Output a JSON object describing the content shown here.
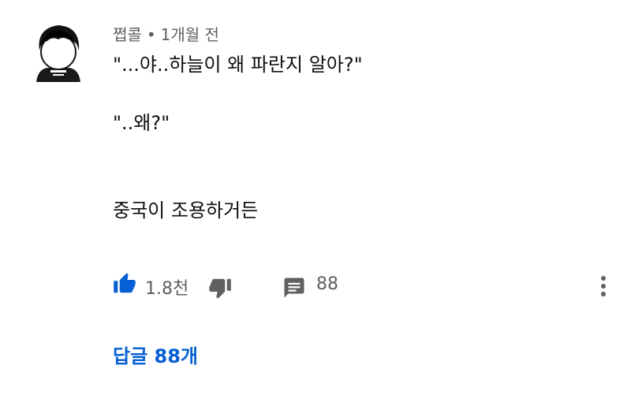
{
  "comment": {
    "author": "쩝콜",
    "separator": "•",
    "time": "1개월 전",
    "lines": [
      "\"...야..하늘이 왜 파란지 알아?\"",
      "",
      "\"..왜?\"",
      "",
      "",
      "중국이 조용하거든"
    ]
  },
  "actions": {
    "like_count": "1.8천",
    "reply_count": "88"
  },
  "replies": {
    "label": "답글 88개"
  },
  "colors": {
    "accent": "#065fd4",
    "secondary_text": "#606060",
    "icon_gray": "#606060"
  },
  "icons": {
    "like": "thumbs-up-icon",
    "dislike": "thumbs-down-icon",
    "reply": "comment-icon",
    "more": "more-vertical-icon"
  }
}
